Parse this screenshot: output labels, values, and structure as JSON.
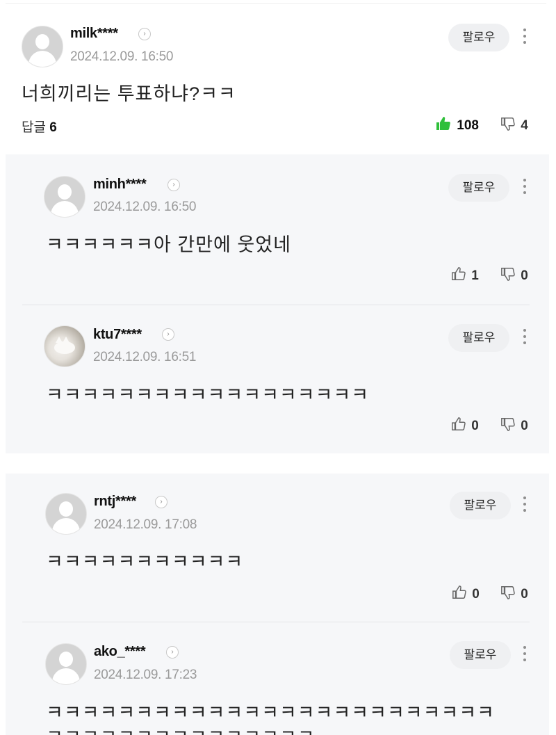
{
  "follow_label": "팔로우",
  "main_comment": {
    "username": "milk****",
    "timestamp": "2024.12.09. 16:50",
    "text": "너희끼리는 투표하냐?ㅋㅋ",
    "reply_label": "답글",
    "reply_count": "6",
    "likes": "108",
    "dislikes": "4",
    "liked_color": "#2fbf3a"
  },
  "replies": [
    {
      "username": "minh****",
      "timestamp": "2024.12.09. 16:50",
      "text": "ㅋㅋㅋㅋㅋㅋ아 간만에 웃었네",
      "likes": "1",
      "dislikes": "0",
      "avatar": "default-avatar"
    },
    {
      "username": "ktu7****",
      "timestamp": "2024.12.09. 16:51",
      "text": "ㅋㅋㅋㅋㅋㅋㅋㅋㅋㅋㅋㅋㅋㅋㅋㅋㅋㅋ",
      "likes": "0",
      "dislikes": "0",
      "avatar": "cat-photo-avatar"
    },
    {
      "username": "rntj****",
      "timestamp": "2024.12.09. 17:08",
      "text": "ㅋㅋㅋㅋㅋㅋㅋㅋㅋㅋㅋ",
      "likes": "0",
      "dislikes": "0",
      "avatar": "default-avatar"
    },
    {
      "username": "ako_****",
      "timestamp": "2024.12.09. 17:23",
      "text": "ㅋㅋㅋㅋㅋㅋㅋㅋㅋㅋㅋㅋㅋㅋㅋㅋㅋㅋㅋㅋㅋㅋㅋㅋㅋ",
      "text_line2": "ㅋㅋㅋㅋㅋㅋㅋㅋㅋㅋㅋㅋㅋㅋㅋ",
      "avatar": "default-avatar"
    }
  ]
}
